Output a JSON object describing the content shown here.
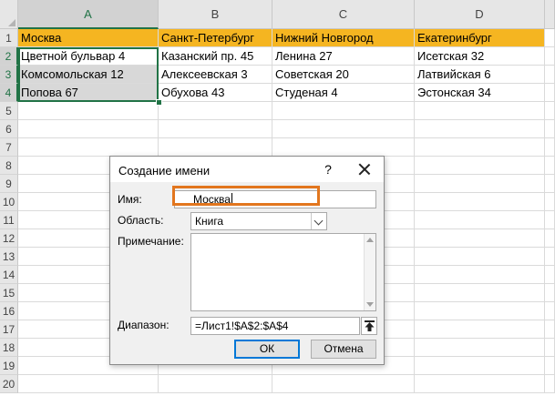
{
  "columns": [
    "A",
    "B",
    "C",
    "D"
  ],
  "rows": [
    "1",
    "2",
    "3",
    "4",
    "5",
    "6",
    "7",
    "8",
    "9",
    "10",
    "11",
    "12",
    "13",
    "14",
    "15",
    "16",
    "17",
    "18",
    "19",
    "20"
  ],
  "cells": [
    [
      "Москва",
      "Санкт-Петербург",
      "Нижний Новгород",
      "Екатеринбург"
    ],
    [
      "Цветной бульвар 4",
      "Казанский пр. 45",
      "Ленина 27",
      "Исетская 32"
    ],
    [
      "Комсомольская 12",
      "Алексеевская 3",
      "Советская 20",
      "Латвийская 6"
    ],
    [
      "Попова 67",
      "Обухова 43",
      "Студеная 4",
      "Эстонская 34"
    ]
  ],
  "colors": {
    "header_row_fill": "#f5b521",
    "selection_accent": "#217346",
    "highlight_outline": "#e2761e"
  },
  "dialog": {
    "title": "Создание имени",
    "help": "?",
    "name_label": "Имя:",
    "name_value": "Москва",
    "scope_label": "Область:",
    "scope_value": "Книга",
    "comment_label": "Примечание:",
    "comment_value": "",
    "range_label": "Диапазон:",
    "range_value": "=Лист1!$A$2:$A$4",
    "ok_label": "ОК",
    "cancel_label": "Отмена"
  }
}
